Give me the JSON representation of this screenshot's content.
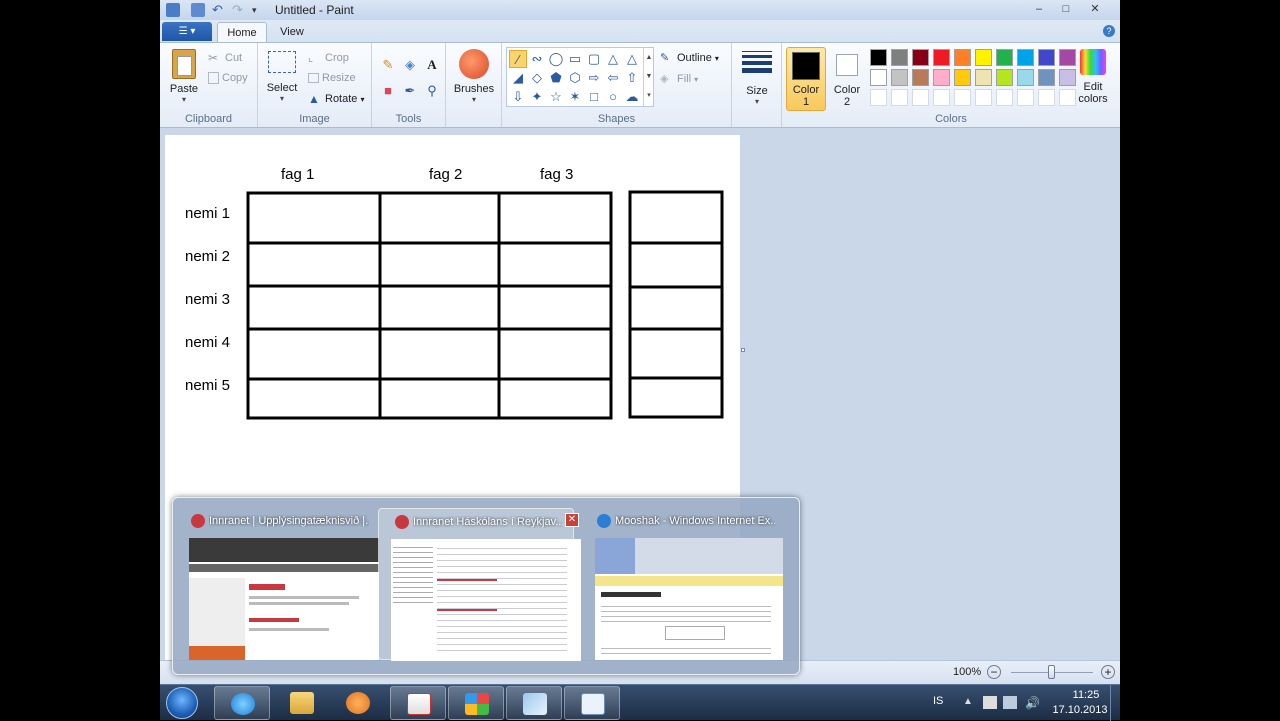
{
  "window": {
    "title": "Untitled - Paint",
    "minimize": "–",
    "maximize": "□",
    "close": "✕"
  },
  "tabs": {
    "file": "☰ ▾",
    "home": "Home",
    "view": "View",
    "help": "?"
  },
  "ribbon": {
    "clipboard": {
      "label": "Clipboard",
      "paste": "Paste",
      "cut": "Cut",
      "copy": "Copy"
    },
    "image": {
      "label": "Image",
      "select": "Select",
      "crop": "Crop",
      "resize": "Resize",
      "rotate": "Rotate"
    },
    "tools": {
      "label": "Tools"
    },
    "brushes": {
      "label": "Brushes"
    },
    "shapes": {
      "label": "Shapes",
      "outline": "Outline",
      "fill": "Fill"
    },
    "size": {
      "label": "Size"
    },
    "colors": {
      "label": "Colors",
      "color1": "Color\n1",
      "color2": "Color\n2",
      "color1_value": "#000000",
      "color2_value": "#ffffff",
      "edit": "Edit\ncolors",
      "palette_row1": [
        "#000000",
        "#7f7f7f",
        "#880015",
        "#ed1c24",
        "#ff7f27",
        "#fff200",
        "#22b14c",
        "#00a2e8",
        "#3f48cc",
        "#a349a4"
      ],
      "palette_row2": [
        "#ffffff",
        "#c3c3c3",
        "#b97a57",
        "#ffaec9",
        "#ffc90e",
        "#efe4b0",
        "#b5e61d",
        "#99d9ea",
        "#7092be",
        "#c8bfe7"
      ]
    }
  },
  "canvas": {
    "columns": [
      "fag 1",
      "fag 2",
      "fag 3"
    ],
    "rows": [
      "nemi 1",
      "nemi 2",
      "nemi 3",
      "nemi 4",
      "nemi 5"
    ]
  },
  "statusbar": {
    "zoom": "100%",
    "zoom_out": "−",
    "zoom_in": "+",
    "zoom_level": 0.5
  },
  "preview": {
    "windows": [
      {
        "title": "Innranet | Upplýsingatæknisvið |...",
        "icon_color": "#c8383e"
      },
      {
        "title": "Innranet Háskólans í Reykjav...",
        "icon_color": "#c8383e",
        "close": "✕"
      },
      {
        "title": "Mooshak - Windows Internet Ex...",
        "icon_color": "#2a7fd4"
      }
    ]
  },
  "taskbar": {
    "language": "IS",
    "time": "11:25",
    "date": "17.10.2013"
  }
}
